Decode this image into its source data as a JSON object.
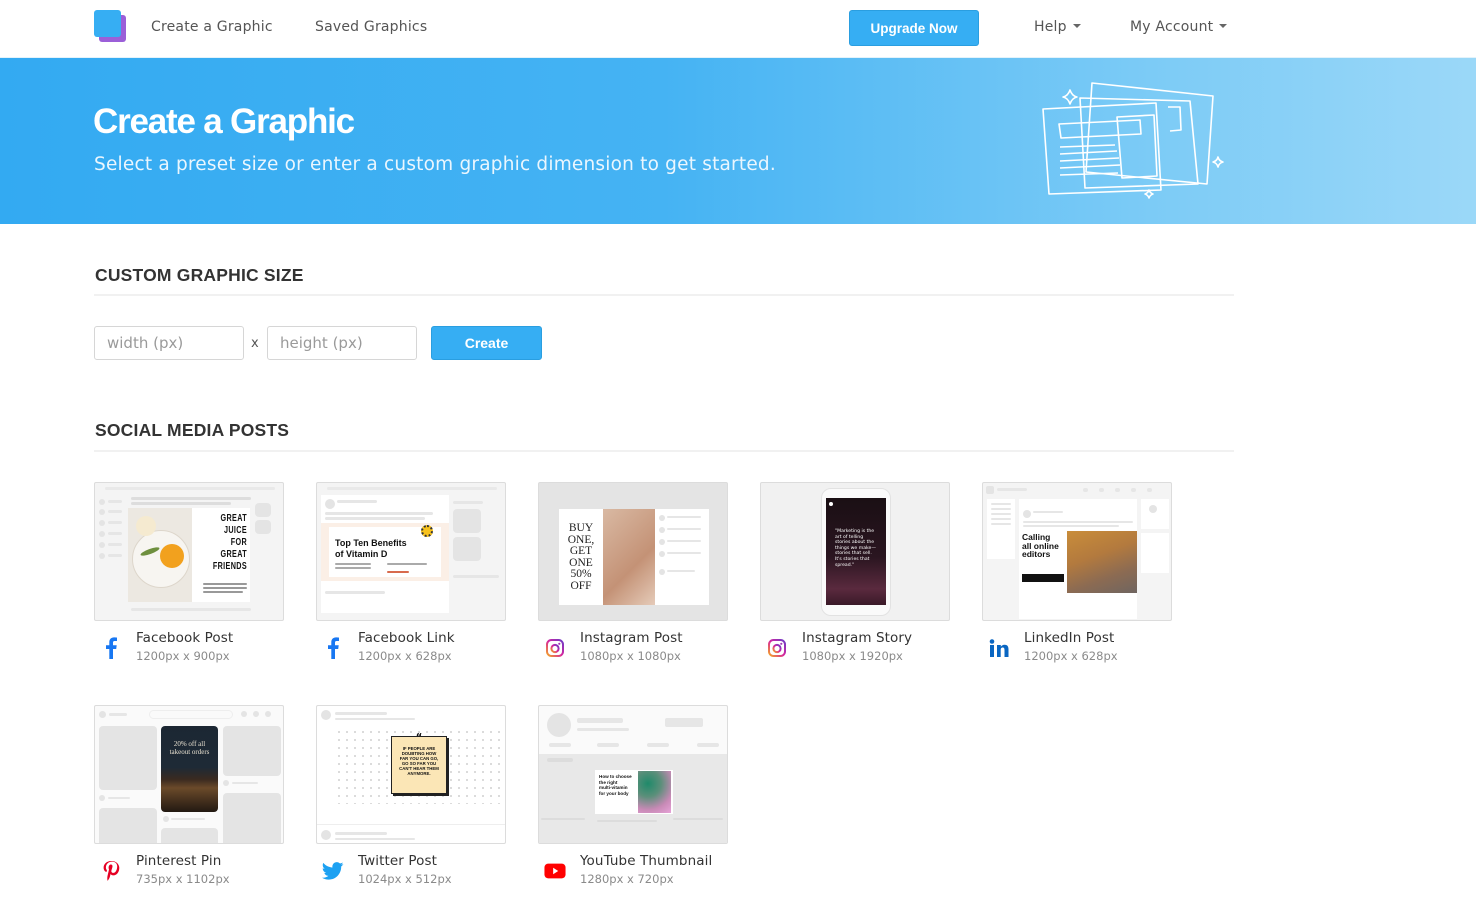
{
  "navbar": {
    "logo_name": "app-logo",
    "links": [
      {
        "label": "Create a Graphic"
      },
      {
        "label": "Saved Graphics"
      }
    ],
    "upgrade_label": "Upgrade Now",
    "help_label": "Help",
    "account_label": "My Account"
  },
  "hero": {
    "title": "Create a Graphic",
    "subtitle": "Select a preset size or enter a custom graphic dimension to get started."
  },
  "custom_size": {
    "title": "CUSTOM GRAPHIC SIZE",
    "width_placeholder": "width (px)",
    "width_value": "",
    "separator": "x",
    "height_placeholder": "height (px)",
    "height_value": "",
    "create_label": "Create"
  },
  "social": {
    "title": "SOCIAL MEDIA POSTS",
    "presets": [
      {
        "name": "Facebook Post",
        "dims": "1200px x 900px",
        "icon": "facebook-icon",
        "thumb_text": [
          "GREAT",
          "JUICE FOR",
          "GREAT",
          "FRIENDS"
        ]
      },
      {
        "name": "Facebook Link",
        "dims": "1200px x 628px",
        "icon": "facebook-icon",
        "thumb_text": [
          "Top Ten Benefits",
          "of Vitamin D"
        ]
      },
      {
        "name": "Instagram Post",
        "dims": "1080px x 1080px",
        "icon": "instagram-icon",
        "thumb_text": [
          "BUY",
          "ONE,",
          "GET",
          "ONE",
          "50%",
          "OFF"
        ]
      },
      {
        "name": "Instagram Story",
        "dims": "1080px x 1920px",
        "icon": "instagram-icon",
        "thumb_text": [
          "\"Marketing is the art of telling stories about the things we make—stories that sell. It's stories that spread.\""
        ]
      },
      {
        "name": "LinkedIn Post",
        "dims": "1200px x 628px",
        "icon": "linkedin-icon",
        "thumb_text": [
          "Calling",
          "all online",
          "editors"
        ]
      },
      {
        "name": "Pinterest Pin",
        "dims": "735px x 1102px",
        "icon": "pinterest-icon",
        "thumb_text": [
          "20% off all",
          "takeout orders"
        ]
      },
      {
        "name": "Twitter Post",
        "dims": "1024px x 512px",
        "icon": "twitter-icon",
        "thumb_text": [
          "IF PEOPLE ARE",
          "DOUBTING HOW",
          "FAR YOU CAN GO,",
          "GO SO FAR YOU",
          "CAN'T HEAR THEM",
          "ANYMORE."
        ]
      },
      {
        "name": "YouTube Thumbnail",
        "dims": "1280px x 720px",
        "icon": "youtube-icon",
        "thumb_text": [
          "How to choose",
          "the right",
          "multi-vitamin",
          "for your body"
        ]
      }
    ]
  },
  "colors": {
    "brand_blue": "#36aef3",
    "brand_purple": "#9b5fd8",
    "facebook": "#1877f2",
    "linkedin": "#0a66c2",
    "pinterest": "#e60023",
    "twitter": "#1da1f2",
    "youtube": "#ff0000"
  }
}
